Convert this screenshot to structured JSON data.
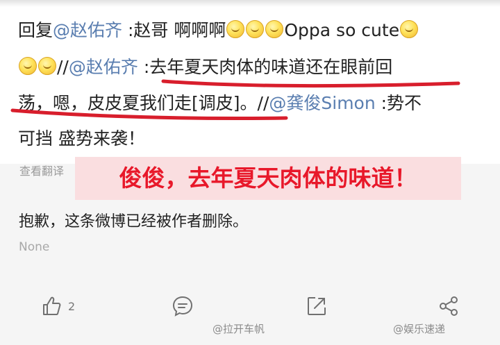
{
  "comment": {
    "reply_prefix": "回复",
    "mention_1": "@赵佑齐",
    "reply_1": " :赵哥 啊啊啊",
    "tail_1": "Oppa so cute",
    "sep_1": "//",
    "mention_2": "@赵佑齐",
    "quote_1": " :去年夏天肉体的味道还在眼前回",
    "quote_2": "荡，嗯，皮皮夏我们走[调皮]。",
    "sep_2": "//",
    "mention_3": "@龚俊Simon",
    "quote_3": " :势不",
    "quote_4": "可挡 盛势来袭！",
    "emoji_icon": "grin-emoji"
  },
  "translate_link": "查看翻译",
  "caption_overlay": "俊俊，去年夏天肉体的味道！",
  "deleted_post": {
    "message": "抱歉，这条微博已经被作者删除。",
    "meta": "None"
  },
  "toolbar": {
    "like_count": "2",
    "like_icon": "thumbs-up-icon",
    "comment_icon": "comment-icon",
    "repost_icon": "repost-icon",
    "share_icon": "share-icon"
  },
  "watermarks": {
    "left": "@拉开车帆",
    "right": "@娱乐速递"
  },
  "colors": {
    "mention": "#5a7eb0",
    "underline": "#d81e2c",
    "caption_text": "#e8182a",
    "caption_bg": "#fadee0"
  }
}
